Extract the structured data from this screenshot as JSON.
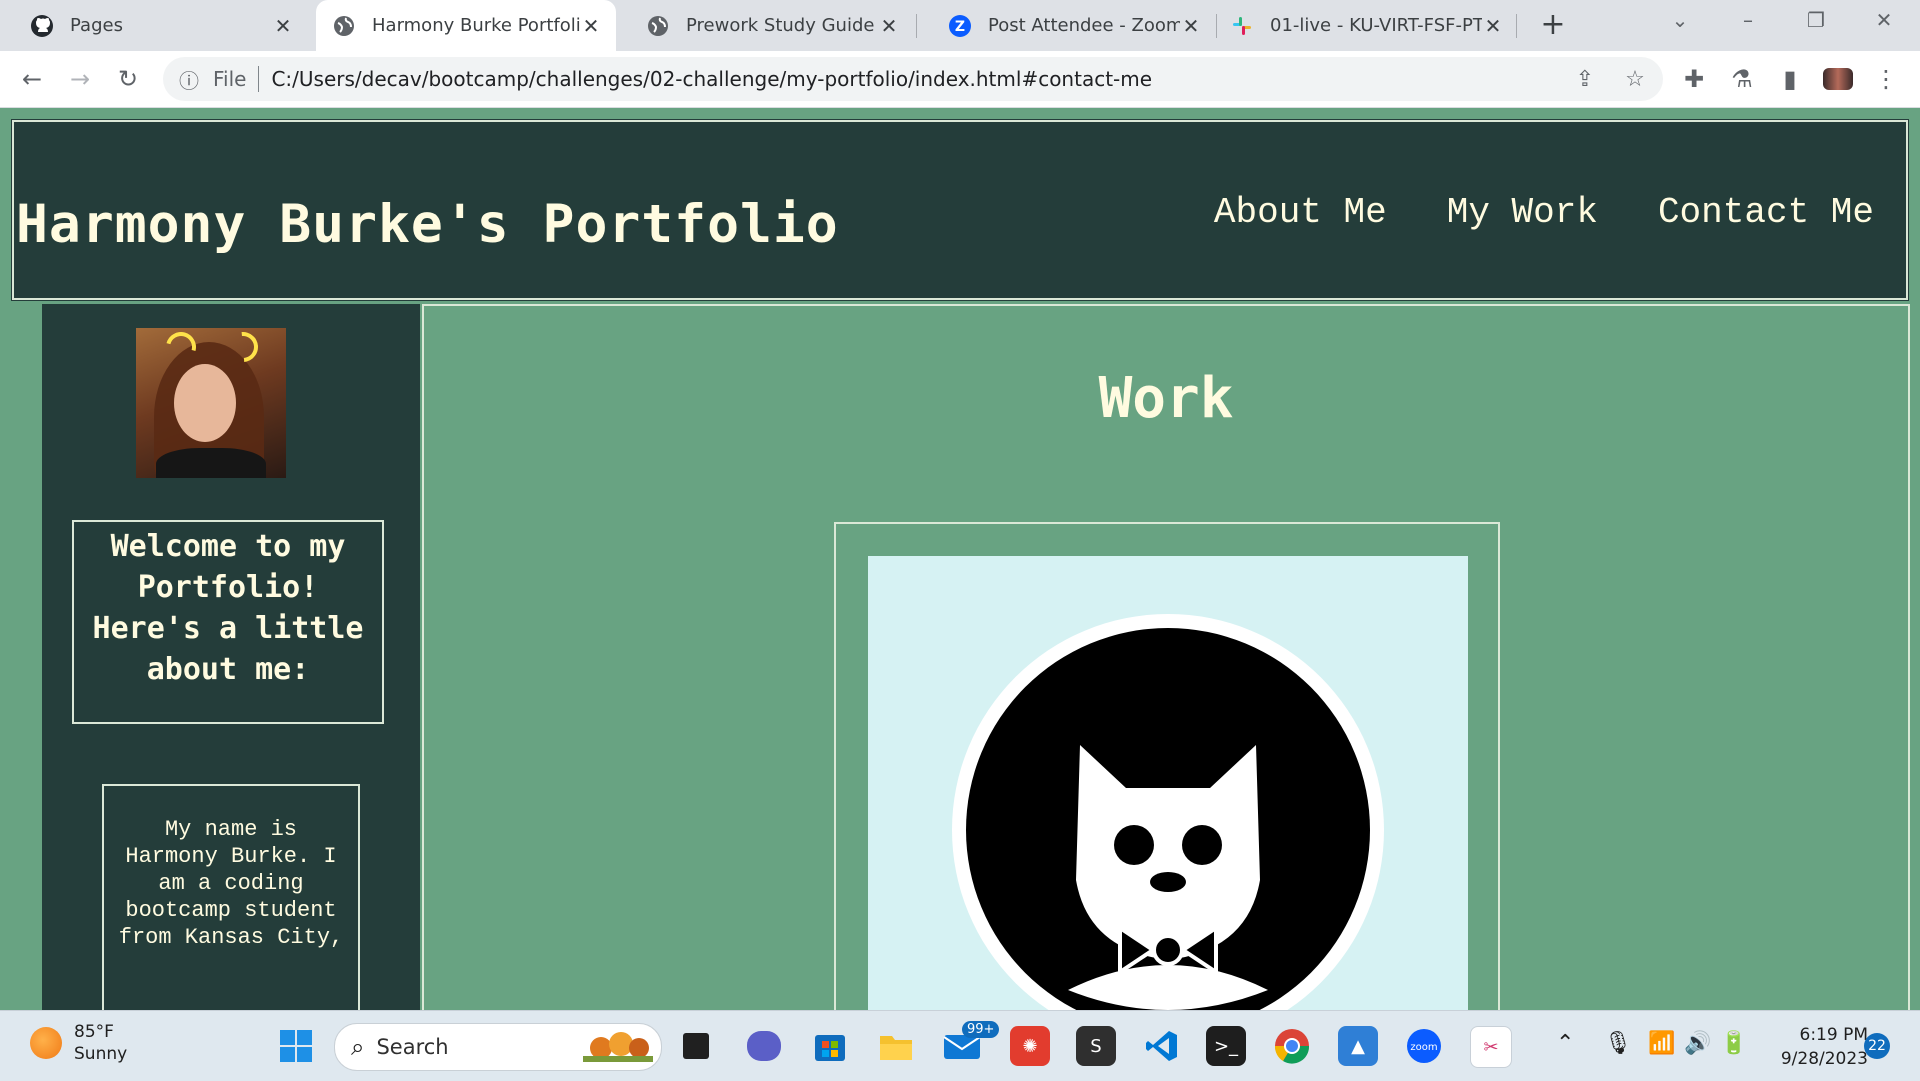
{
  "browser": {
    "tabs": [
      {
        "title": "Pages",
        "icon": "github-icon",
        "active": false
      },
      {
        "title": "Harmony Burke Portfolio",
        "icon": "globe-icon",
        "active": true
      },
      {
        "title": "Prework Study Guide",
        "icon": "globe-icon",
        "active": false
      },
      {
        "title": "Post Attendee - Zoom",
        "icon": "zoom-icon",
        "active": false
      },
      {
        "title": "01-live - KU-VIRT-FSF-PT",
        "icon": "slack-icon",
        "active": false
      }
    ],
    "omnibox": {
      "scheme_label": "File",
      "url": "C:/Users/decav/bootcamp/challenges/02-challenge/my-portfolio/index.html#contact-me"
    }
  },
  "site": {
    "title": "Harmony Burke's Portfolio",
    "nav": [
      "About Me",
      "My Work",
      "Contact Me"
    ],
    "sidebar": {
      "welcome": "Welcome to my Portfolio! Here's a little about me:",
      "bio": "My name is Harmony Burke. I am a coding bootcamp student from Kansas City,"
    },
    "main": {
      "section_title": "Work"
    },
    "colors": {
      "page_bg": "#68a382",
      "panel_bg": "#243d3a",
      "text": "#fffbe0",
      "image_bg": "#d6f2f3"
    }
  },
  "taskbar": {
    "weather_temp": "85°F",
    "weather_desc": "Sunny",
    "search_label": "Search",
    "mail_badge": "99+",
    "time": "6:19 PM",
    "date": "9/28/2023",
    "notification_count": "22"
  }
}
